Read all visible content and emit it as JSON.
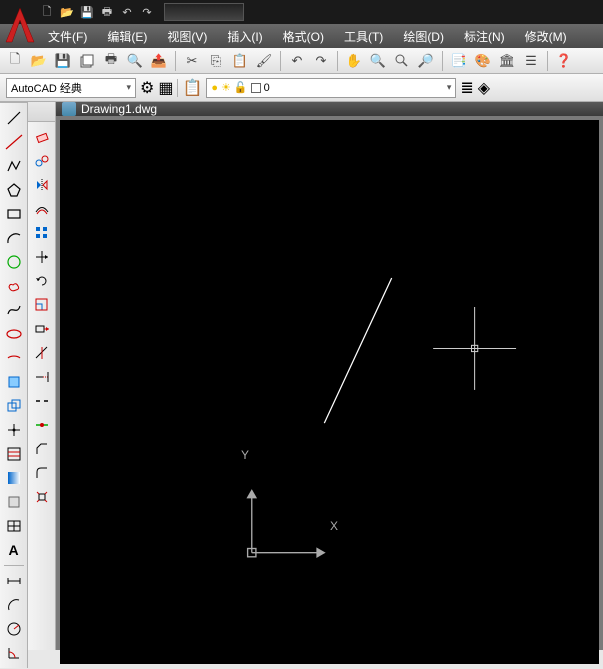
{
  "titlebar": {
    "qat": [
      "new",
      "open",
      "save",
      "print",
      "undo",
      "redo"
    ]
  },
  "menubar": {
    "items": [
      {
        "label": "文件(F)"
      },
      {
        "label": "编辑(E)"
      },
      {
        "label": "视图(V)"
      },
      {
        "label": "插入(I)"
      },
      {
        "label": "格式(O)"
      },
      {
        "label": "工具(T)"
      },
      {
        "label": "绘图(D)"
      },
      {
        "label": "标注(N)"
      },
      {
        "label": "修改(M)"
      }
    ]
  },
  "toolbar1": {
    "groups": [
      [
        "new",
        "open",
        "save",
        "saveall",
        "print",
        "preview",
        "publish"
      ],
      [
        "cut",
        "copy",
        "paste",
        "match-prop"
      ],
      [
        "undo",
        "redo"
      ],
      [
        "pan",
        "zoom-realtime",
        "zoom-win",
        "zoom-prev"
      ],
      [
        "sheet",
        "tool-palette",
        "design-center",
        "props"
      ]
    ]
  },
  "workspace": {
    "label": "AutoCAD 经典",
    "gear_icon": "⚙",
    "ws_icon": "☰"
  },
  "layer": {
    "current": "0",
    "bulb": "●",
    "sun": "☀",
    "lock": "🔓",
    "layer_panel": "📋"
  },
  "document": {
    "name": "Drawing1.dwg"
  },
  "ucs": {
    "x_label": "X",
    "y_label": "Y"
  },
  "draw_tools": [
    "line",
    "construction-line",
    "polyline",
    "polygon",
    "rectangle",
    "arc",
    "circle",
    "revcloud",
    "spline",
    "ellipse",
    "ellipse-arc",
    "insert-block",
    "make-block",
    "point",
    "hatch",
    "gradient",
    "region",
    "table",
    "text"
  ],
  "modify_tools": [
    "erase",
    "copy",
    "mirror",
    "offset",
    "array",
    "move",
    "rotate",
    "scale",
    "stretch",
    "trim",
    "extend",
    "break",
    "join",
    "chamfer",
    "fillet",
    "explode"
  ]
}
